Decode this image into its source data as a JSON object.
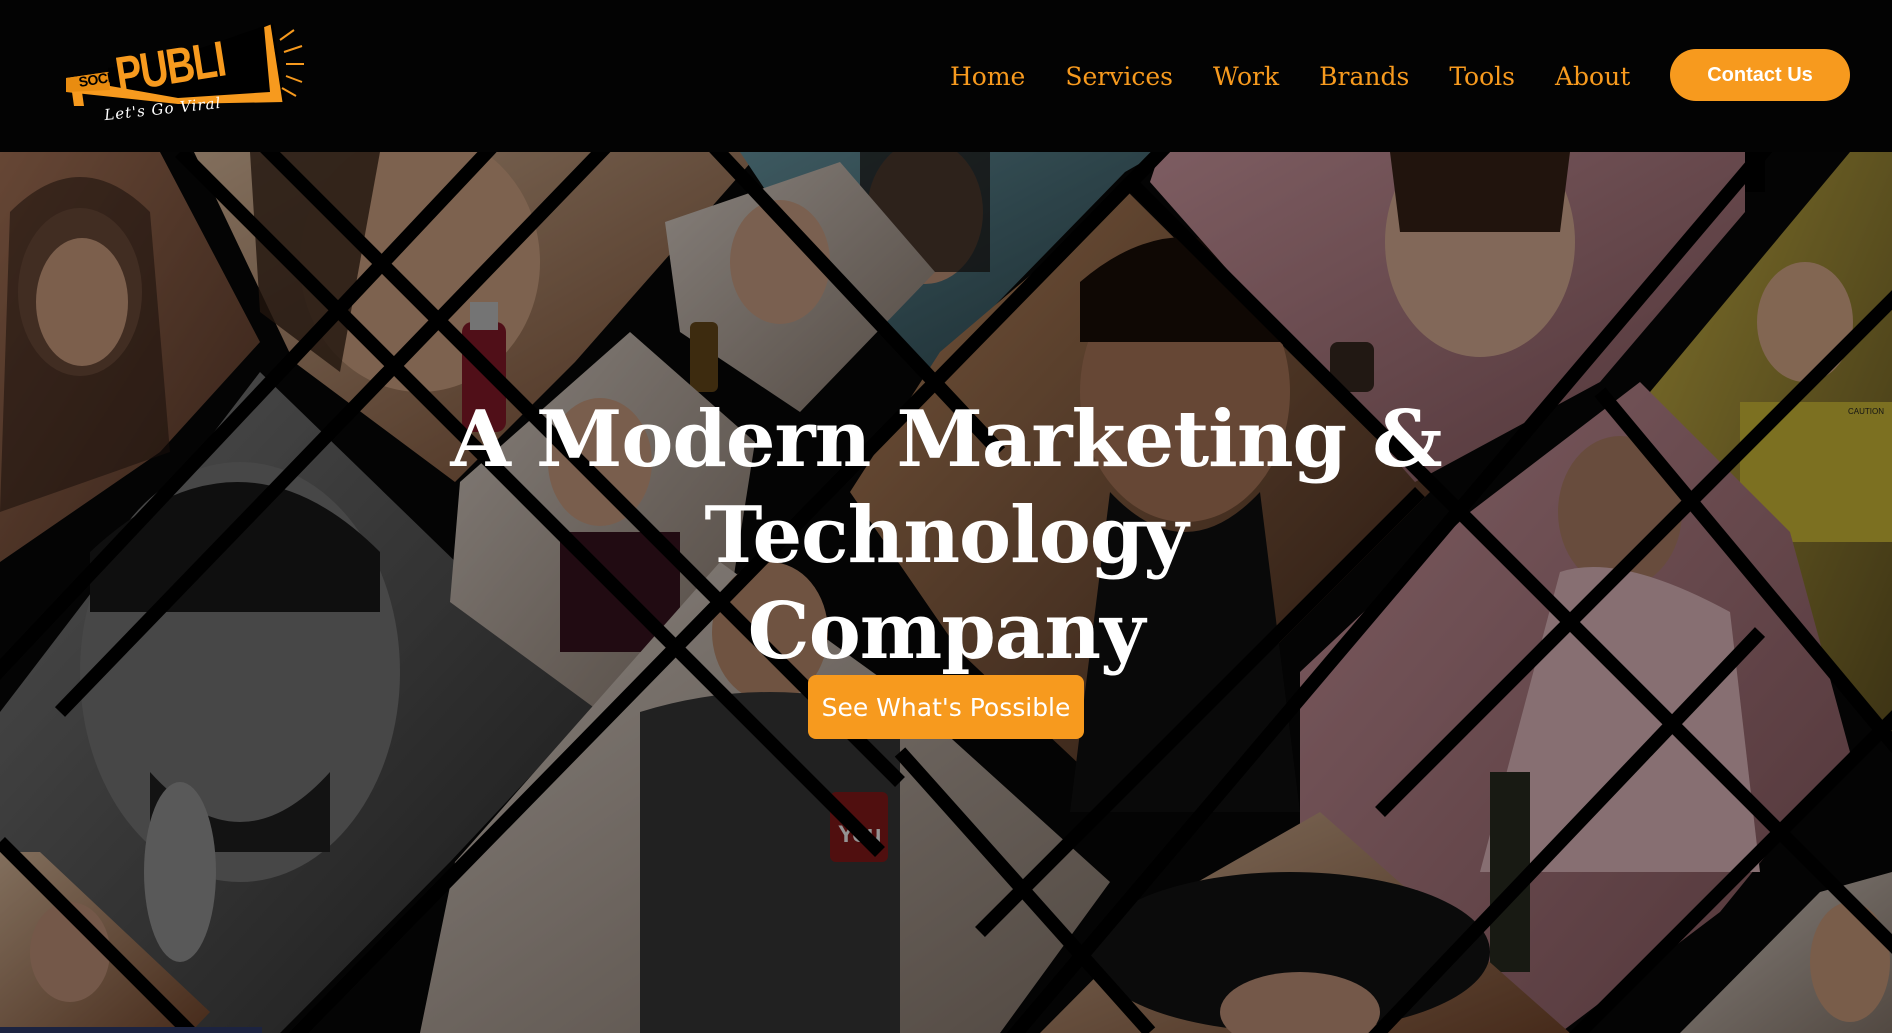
{
  "brand": {
    "logo_line1": "SOCIAL",
    "logo_line2": "PUBLI",
    "tagline": "Let's Go Viral",
    "accent_color": "#f79a1e"
  },
  "nav": {
    "items": [
      {
        "label": "Home"
      },
      {
        "label": "Services"
      },
      {
        "label": "Work"
      },
      {
        "label": "Brands"
      },
      {
        "label": "Tools"
      },
      {
        "label": "About"
      }
    ],
    "cta_label": "Contact Us"
  },
  "hero": {
    "title_line1": "A Modern Marketing & Technology",
    "title_line2": "Company",
    "cta_label": "See What's Possible",
    "photo_label": "CAUTION",
    "badge_text": "You"
  }
}
